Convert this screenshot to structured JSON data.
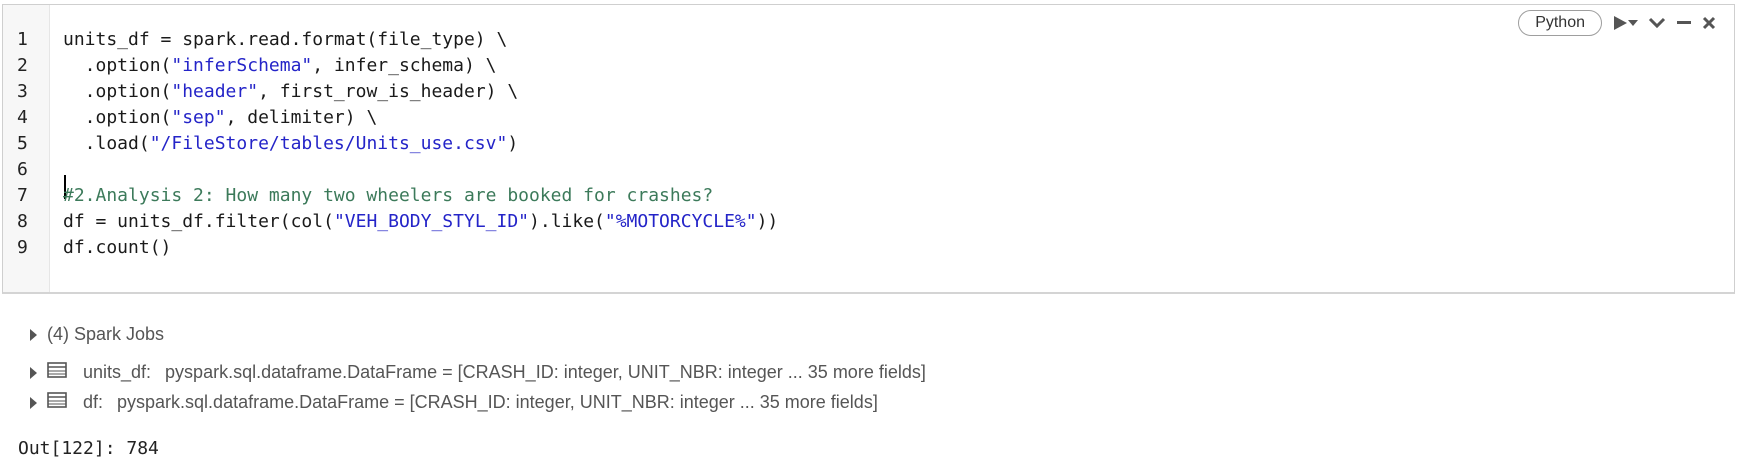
{
  "cell": {
    "language_label": "Python",
    "line_numbers": [
      "1",
      "2",
      "3",
      "4",
      "5",
      "6",
      "7",
      "8",
      "9"
    ],
    "code": {
      "l1": "units_df = spark.read.format(file_type) \\",
      "l2a": "  .option(",
      "l2s": "\"inferSchema\"",
      "l2b": ", infer_schema) \\",
      "l3a": "  .option(",
      "l3s": "\"header\"",
      "l3b": ", first_row_is_header) \\",
      "l4a": "  .option(",
      "l4s": "\"sep\"",
      "l4b": ", delimiter) \\",
      "l5a": "  .load(",
      "l5s": "\"/FileStore/tables/Units_use.csv\"",
      "l5b": ")",
      "l7": "#2.Analysis 2: How many two wheelers are booked for crashes?",
      "l8a": "df = units_df.filter(col(",
      "l8s": "\"VEH_BODY_STYL_ID\"",
      "l8b": ").like(",
      "l8s2": "\"%MOTORCYCLE%\"",
      "l8c": "))",
      "l9": "df.count()"
    },
    "toolbar_icons": [
      "run-icon",
      "dropdown-icon",
      "collapse-icon",
      "minimize-icon",
      "close-icon"
    ]
  },
  "output": {
    "spark_jobs": "(4) Spark Jobs",
    "dataframes": [
      {
        "name": "units_df:",
        "type": "pyspark.sql.dataframe.DataFrame = [CRASH_ID: integer, UNIT_NBR: integer ... 35 more fields]"
      },
      {
        "name": "df:",
        "type": "pyspark.sql.dataframe.DataFrame = [CRASH_ID: integer, UNIT_NBR: integer ... 35 more fields]"
      }
    ],
    "result": "Out[122]: 784"
  }
}
